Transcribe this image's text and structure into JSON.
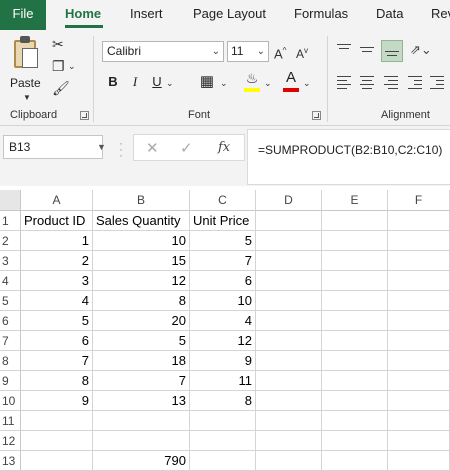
{
  "tabs": [
    {
      "label": "File",
      "active": false
    },
    {
      "label": "Home",
      "active": true
    },
    {
      "label": "Insert",
      "active": false
    },
    {
      "label": "Page Layout",
      "active": false
    },
    {
      "label": "Formulas",
      "active": false
    },
    {
      "label": "Data",
      "active": false
    },
    {
      "label": "Rev",
      "active": false
    }
  ],
  "ribbon": {
    "clipboard": {
      "paste_label": "Paste",
      "group_label": "Clipboard"
    },
    "font": {
      "font_name": "Calibri",
      "font_size": "11",
      "group_label": "Font",
      "bold": "B",
      "italic": "I",
      "underline": "U",
      "fill_color": "#ffff00",
      "font_color": "#e00000"
    },
    "alignment": {
      "group_label": "Alignment"
    }
  },
  "formula_bar": {
    "name_box": "B13",
    "formula": "=SUMPRODUCT(B2:B10,C2:C10)"
  },
  "sheet": {
    "columns": [
      "A",
      "B",
      "C",
      "D",
      "E",
      "F"
    ],
    "rows": [
      {
        "n": "1",
        "cells": [
          "Product ID",
          "Sales Quantity",
          "Unit Price",
          "",
          "",
          ""
        ]
      },
      {
        "n": "2",
        "cells": [
          "1",
          "10",
          "5",
          "",
          "",
          ""
        ]
      },
      {
        "n": "3",
        "cells": [
          "2",
          "15",
          "7",
          "",
          "",
          ""
        ]
      },
      {
        "n": "4",
        "cells": [
          "3",
          "12",
          "6",
          "",
          "",
          ""
        ]
      },
      {
        "n": "5",
        "cells": [
          "4",
          "8",
          "10",
          "",
          "",
          ""
        ]
      },
      {
        "n": "6",
        "cells": [
          "5",
          "20",
          "4",
          "",
          "",
          ""
        ]
      },
      {
        "n": "7",
        "cells": [
          "6",
          "5",
          "12",
          "",
          "",
          ""
        ]
      },
      {
        "n": "8",
        "cells": [
          "7",
          "18",
          "9",
          "",
          "",
          ""
        ]
      },
      {
        "n": "9",
        "cells": [
          "8",
          "7",
          "11",
          "",
          "",
          ""
        ]
      },
      {
        "n": "10",
        "cells": [
          "9",
          "13",
          "8",
          "",
          "",
          ""
        ]
      },
      {
        "n": "11",
        "cells": [
          "",
          "",
          "",
          "",
          "",
          ""
        ]
      },
      {
        "n": "12",
        "cells": [
          "",
          "",
          "",
          "",
          "",
          ""
        ]
      },
      {
        "n": "13",
        "cells": [
          "",
          "790",
          "",
          "",
          "",
          ""
        ]
      }
    ]
  },
  "colors": {
    "accent": "#217346",
    "grid_line": "#d4d4d4"
  }
}
